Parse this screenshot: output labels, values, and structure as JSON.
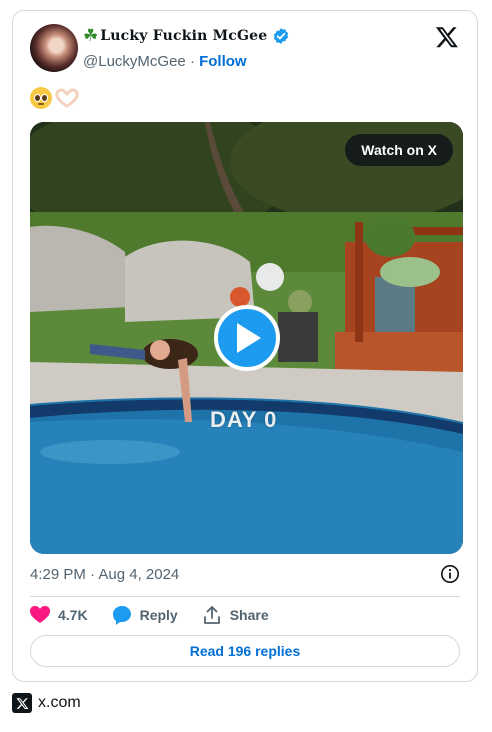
{
  "tweet": {
    "display_name": "Lucky Fuckin McGee",
    "handle": "@LuckyMcGee",
    "separator": "·",
    "follow_label": "Follow",
    "text_emojis": "🥹🫶🏻",
    "watch_label": "Watch on X",
    "video_overlay_text": "DAY 0",
    "timestamp": "4:29 PM · Aug 4, 2024",
    "likes": "4.7K",
    "reply_label": "Reply",
    "share_label": "Share",
    "read_replies_label": "Read 196 replies"
  },
  "footer": {
    "site": "x.com"
  },
  "colors": {
    "brand_blue": "#1d9bf0",
    "link_blue": "#006fd6",
    "like_pink": "#f91880",
    "text_gray": "#536471"
  }
}
